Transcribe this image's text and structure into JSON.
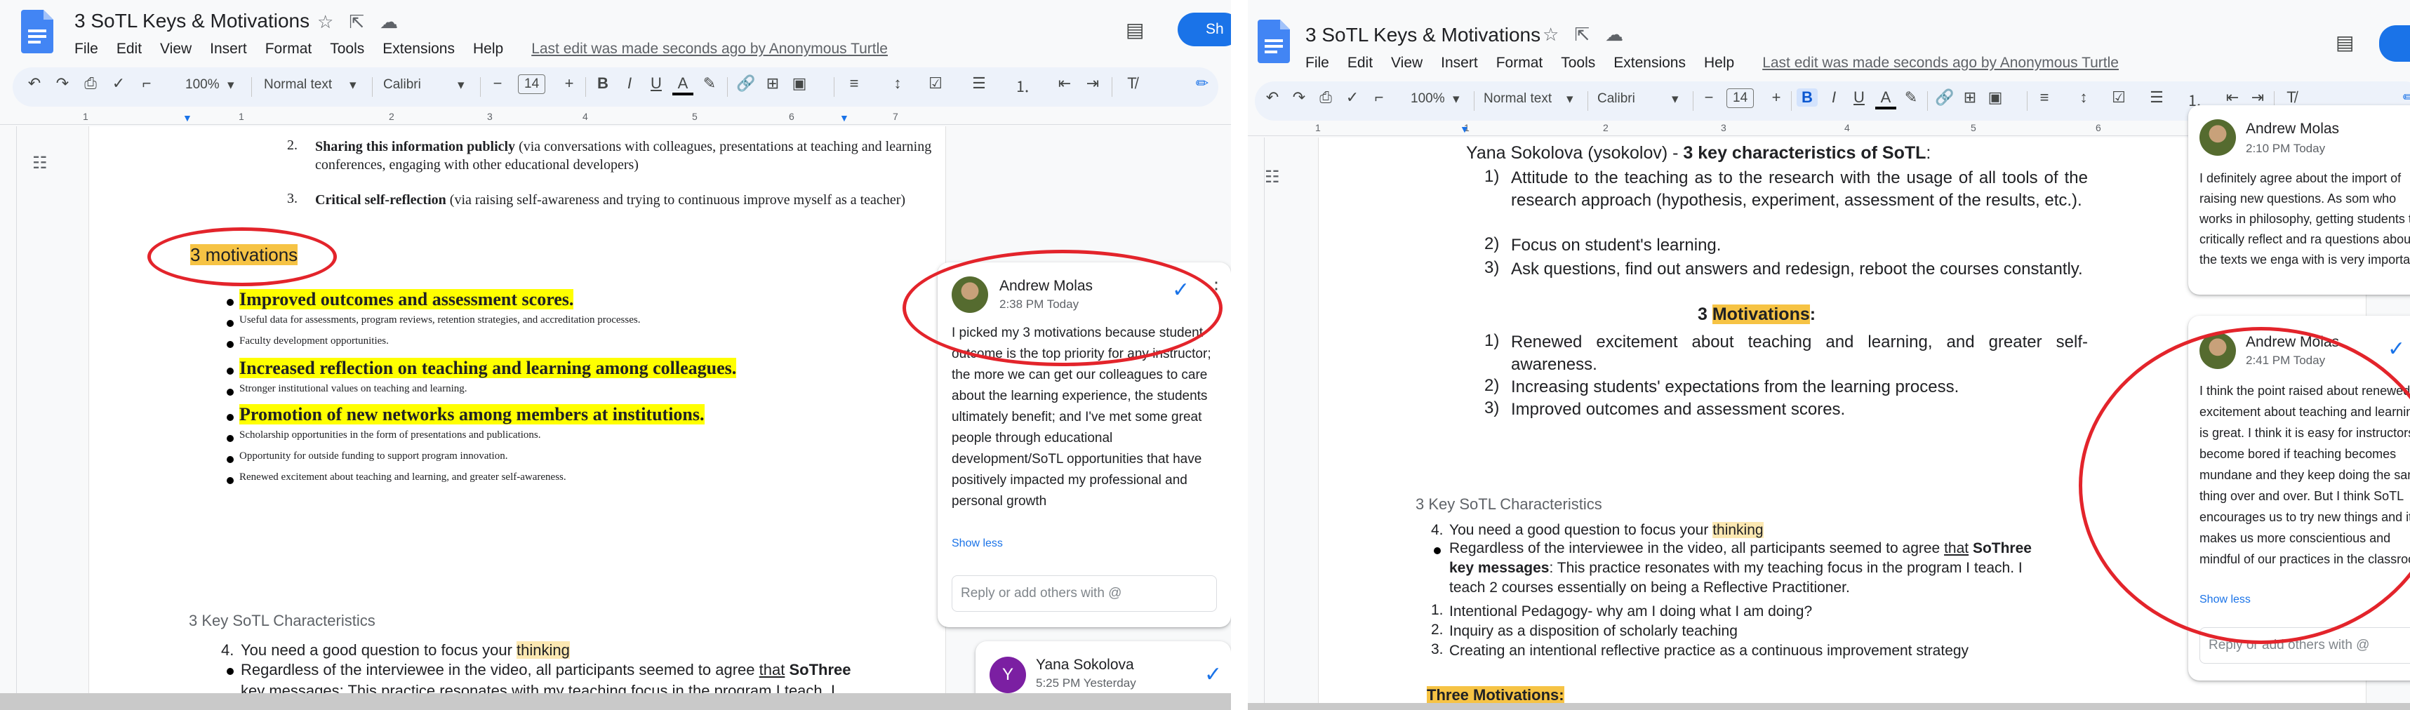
{
  "doc": {
    "title": "3 SoTL Keys & Motivations",
    "menu": [
      "File",
      "Edit",
      "View",
      "Insert",
      "Format",
      "Tools",
      "Extensions",
      "Help"
    ],
    "last_edit": "Last edit was made seconds ago by Anonymous Turtle",
    "share_label": "Sh"
  },
  "toolbar": {
    "zoom": "100%",
    "style": "Normal text",
    "font": "Calibri",
    "font_size": "14",
    "minus": "−",
    "plus": "+",
    "bold": "B",
    "italic": "I",
    "underline": "U",
    "textcolor": "A"
  },
  "ruler": [
    "1",
    "1",
    "2",
    "3",
    "4",
    "5",
    "6",
    "7"
  ],
  "ruler_right": [
    "1",
    "1",
    "2",
    "3",
    "4",
    "5",
    "6",
    "7"
  ],
  "left": {
    "item2_num": "2.",
    "item2_bold": "Sharing this information publicly",
    "item2_rest": " (via conversations with colleagues, presentations at teaching and learning conferences, engaging with other educational developers)",
    "item3_num": "3.",
    "item3_bold": "Critical self-reflection",
    "item3_rest": " (via raising self-awareness and trying to continuous improve myself as a teacher)",
    "motivations_heading": "3 motivations",
    "bullets": [
      {
        "text": "Improved outcomes and assessment scores.",
        "big": true
      },
      {
        "text": "Useful data for assessments, program reviews, retention strategies, and accreditation processes.",
        "big": false
      },
      {
        "text": "Faculty development opportunities.",
        "big": false
      },
      {
        "text": "Increased reflection on teaching and learning among colleagues.",
        "big": true
      },
      {
        "text": "Stronger institutional values on teaching and learning.",
        "big": false
      },
      {
        "text": "Promotion of new networks among members at institutions.",
        "big": true
      },
      {
        "text": "Scholarship opportunities in the form of presentations and publications.",
        "big": false
      },
      {
        "text": "Opportunity for outside funding to support program innovation.",
        "big": false
      },
      {
        "text": "Renewed excitement about teaching and learning, and greater self-awareness.",
        "big": false
      }
    ],
    "sotl_heading": "3 Key SoTL Characteristics",
    "item4_num": "4.",
    "item4_text": "You need a good question to focus your ",
    "item4_hl": "thinking",
    "bullet_b_pre": "Regardless of the interviewee in the video, all participants seemed to agree ",
    "bullet_b_that": "that",
    "bullet_b_post": " SoThree",
    "cut_line": "key messages: This practice resonates with my teaching focus in the program I teach. I"
  },
  "left_comment": {
    "author": "Andrew Molas",
    "time": "2:38 PM Today",
    "text": "I picked my 3 motivations because student outcome is the top priority for any instructor; the more we can get our colleagues to care about the learning experience, the students ultimately benefit; and I've met some great people through educational development/SoTL opportunities that have positively impacted my professional and personal growth",
    "show_less": "Show less",
    "reply_placeholder": "Reply or add others with @"
  },
  "left_comment2": {
    "author": "Yana Sokolova",
    "time": "5:25 PM Yesterday",
    "initial": "Y"
  },
  "right": {
    "intro_pre": "Yana Sokolova (ysokolov) - ",
    "intro_bold": "3 key characteristics of SoTL",
    "intro_colon": ":",
    "chars": [
      {
        "num": "1)",
        "text": "Attitude to the teaching as to the research with the usage of all tools of the research approach (hypothesis, experiment, assessment of the results, etc.)."
      },
      {
        "num": "2)",
        "text": "Focus on student's learning."
      },
      {
        "num": "3)",
        "text": "Ask questions, find out answers and redesign, reboot the courses constantly."
      }
    ],
    "mot_num": "3",
    "mot_word": "Motivations",
    "mot_colon": ":",
    "mots": [
      {
        "num": "1)",
        "text": "Renewed excitement about teaching and learning, and greater self-awareness."
      },
      {
        "num": "2)",
        "text": "Increasing students' expectations from the learning process."
      },
      {
        "num": "3)",
        "text": "Improved outcomes and assessment scores."
      }
    ],
    "sotl_heading": "3 Key SoTL Characteristics",
    "item4_num": "4.",
    "item4_text": "You need a good question to focus your ",
    "item4_hl": "thinking",
    "bullet_pre": "Regardless of the interviewee in the video, all participants seemed to agree ",
    "bullet_that": "that",
    "bullet_so": " SoThree",
    "bullet_line2_bold": "key messages",
    "bullet_line2_rest": ": This practice resonates with my teaching focus in the program I teach. I",
    "bullet_line3": "teach 2 courses essentially on being a Reflective Practitioner.",
    "sub": [
      {
        "num": "1.",
        "text": "Intentional Pedagogy- why am I doing what I am doing?"
      },
      {
        "num": "2.",
        "text": "Inquiry as a disposition of scholarly teaching"
      },
      {
        "num": "3.",
        "text": "Creating an intentional reflective practice as a continuous improvement strategy"
      }
    ],
    "three_mot": "Three Motivations:"
  },
  "right_comment_top": {
    "author": "Andrew Molas",
    "time": "2:10 PM Today",
    "text": "I definitely agree about the import of raising new questions. As som who works in philosophy, getting students to critically reflect and ra questions about the texts we enga with is very important"
  },
  "right_comment": {
    "author": "Andrew Molas",
    "time": "2:41 PM Today",
    "text": "I think the point raised about renewed excitement about teaching and learning is great. I think it is easy for instructors to become bored if teaching becomes mundane and they keep doing the same thing over and over. But I think SoTL encourages us to try new things and it makes us more conscientious and mindful of our practices in the classroom",
    "show_less": "Show less",
    "reply_placeholder": "Reply or add others with @"
  },
  "colors": {
    "accent": "#1a73e8",
    "highlight_yellow": "#ffff00",
    "highlight_orange": "#f6c344",
    "annotation_red": "#e3242b"
  },
  "icons": [
    "docs-logo-icon",
    "star-icon",
    "move-icon",
    "cloud-icon",
    "comment-history-icon",
    "undo-icon",
    "redo-icon",
    "print-icon",
    "spellcheck-icon",
    "paint-format-icon",
    "outline-icon",
    "resolve-check-icon",
    "more-vert-icon"
  ]
}
